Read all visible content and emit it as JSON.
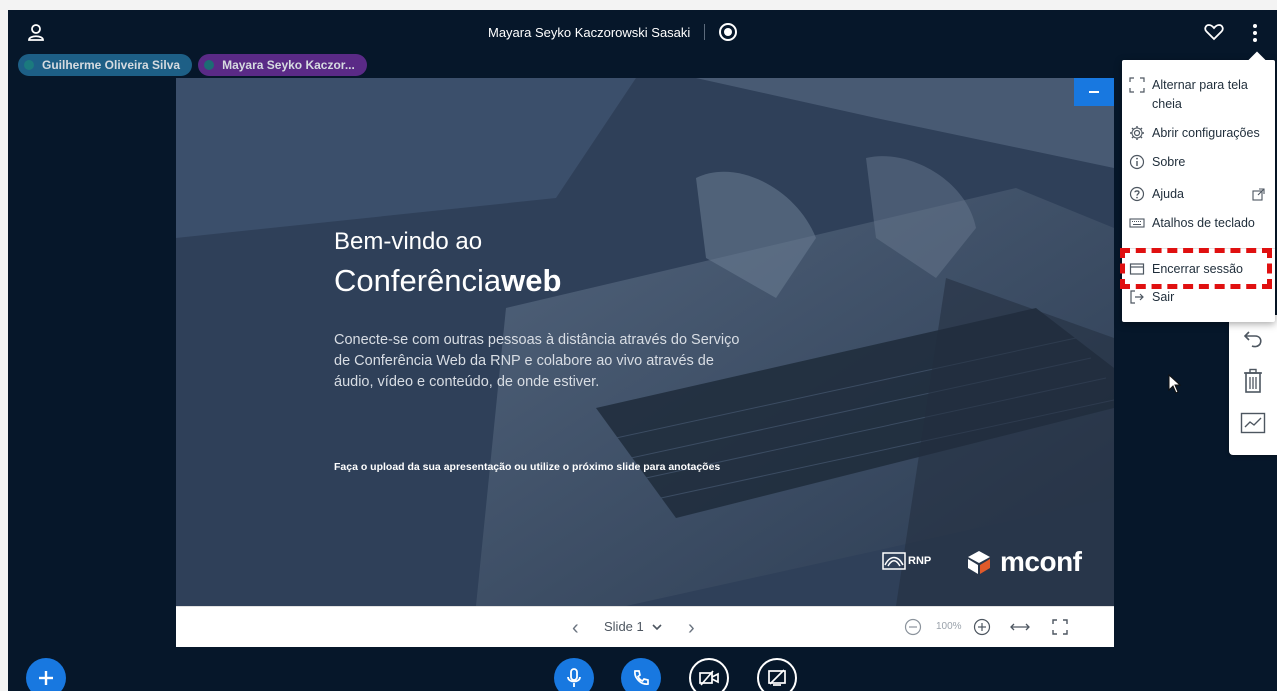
{
  "header": {
    "presenter_name": "Mayara Seyko Kaczorowski Sasaki",
    "icons": [
      "user-icon",
      "record-icon",
      "heart-icon",
      "kebab-menu-icon"
    ]
  },
  "talkers": [
    {
      "name": "Guilherme Oliveira Silva",
      "color": "#1d5f86"
    },
    {
      "name": "Mayara Seyko Kaczor...",
      "color": "#5a2a86"
    }
  ],
  "slide": {
    "heading_line1": "Bem-vindo ao",
    "heading_brand_light": "Conferência",
    "heading_brand_bold": "web",
    "body": "Conecte-se com outras pessoas à distância através do Serviço de Conferência Web da RNP e colabore ao vivo através de áudio, vídeo e conteúdo, de onde estiver.",
    "note": "Faça o upload da sua apresentação ou utilize o próximo slide para anotações",
    "logo_rnp": "RNP",
    "logo_mconf": "mconf"
  },
  "presentation_toolbar": {
    "prev_glyph": "‹",
    "slide_label": "Slide 1",
    "next_glyph": "›",
    "zoom": "100%"
  },
  "options_menu": {
    "items": [
      {
        "label": "Alternar para tela cheia",
        "icon": "fullscreen-icon"
      },
      {
        "label": "Abrir configurações",
        "icon": "gear-icon"
      },
      {
        "label": "Sobre",
        "icon": "info-icon"
      },
      {
        "label": "Ajuda",
        "icon": "help-icon"
      },
      {
        "label": "Atalhos de teclado",
        "icon": "keyboard-icon"
      },
      {
        "label": "Encerrar sessão",
        "icon": "end-session-icon"
      },
      {
        "label": "Sair",
        "icon": "logout-icon"
      }
    ]
  },
  "whiteboard_tools": [
    "undo-icon",
    "trash-icon",
    "multi-user-icon"
  ],
  "colors": {
    "background": "#06172a",
    "accent": "#1878e0",
    "highlight": "#e01010"
  }
}
